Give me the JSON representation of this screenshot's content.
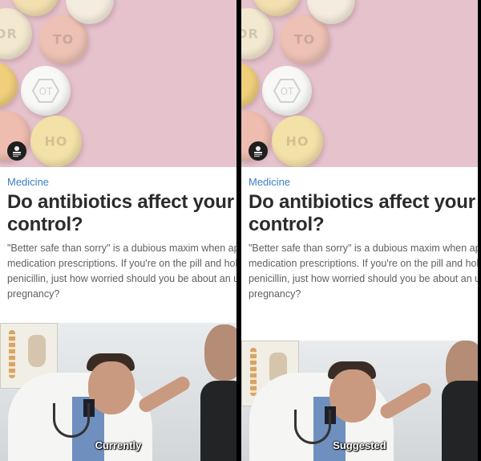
{
  "panels": [
    {
      "id": "currently",
      "category": "Medicine",
      "headline": "Do antibiotics affect your birth control?",
      "excerpt": "\"Better safe than sorry\" is a dubious maxim when applied to medication prescriptions. If you're on the pill and holding out for penicillin, just how worried should you be about an unintended pregnancy?",
      "caption": "Currently"
    },
    {
      "id": "suggested",
      "category": "Medicine",
      "headline": "Do antibiotics affect your birth control?",
      "excerpt": "\"Better safe than sorry\" is a dubious maxim when applied to medication prescriptions. If you're on the pill and holding out for penicillin, just how worried should you be about an unintended pregnancy?",
      "caption": "Suggested"
    }
  ],
  "colors": {
    "hero_background": "#e6c3cc",
    "category_link": "#3a7fc4",
    "headline": "#2b2b2b",
    "excerpt": "#5f5f5f"
  },
  "icons": {
    "author_badge": "person-icon"
  }
}
